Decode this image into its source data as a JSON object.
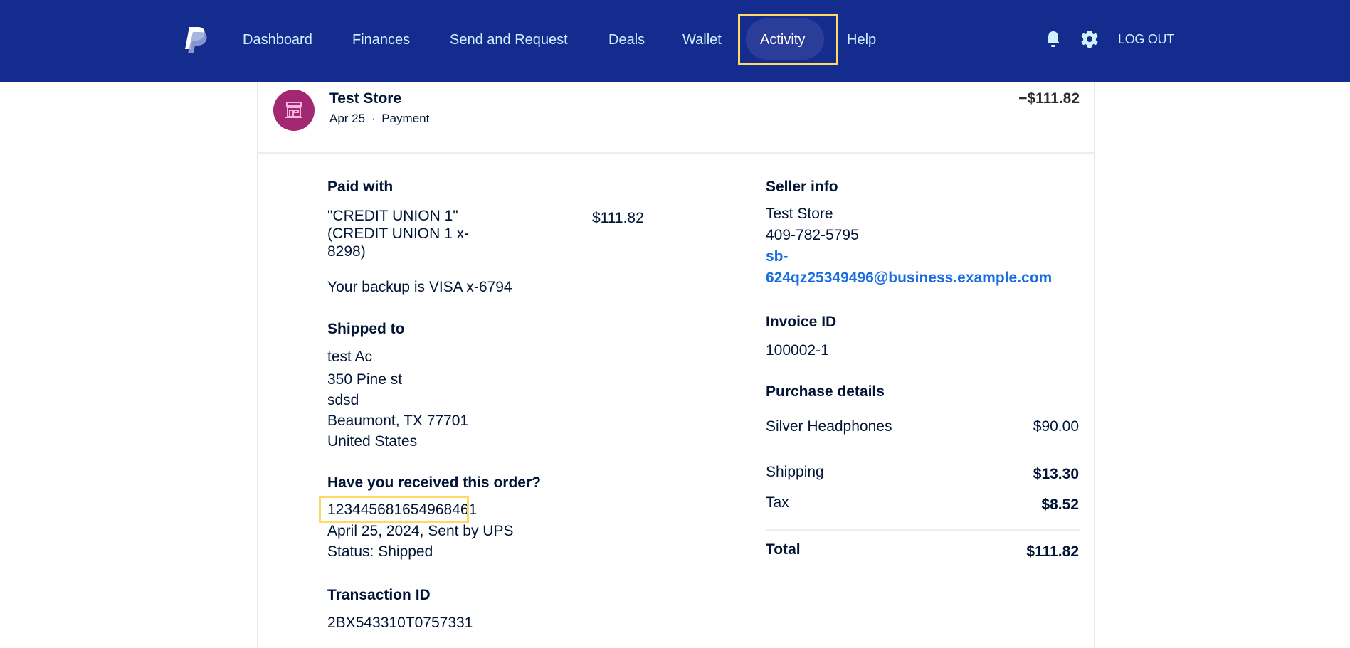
{
  "nav": {
    "items": [
      {
        "label": "Dashboard"
      },
      {
        "label": "Finances"
      },
      {
        "label": "Send and Request"
      },
      {
        "label": "Deals"
      },
      {
        "label": "Wallet"
      },
      {
        "label": "Activity",
        "active": true
      },
      {
        "label": "Help"
      }
    ],
    "notifications_icon": "bell-icon",
    "settings_icon": "gear-icon",
    "logout_label": "LOG OUT"
  },
  "transaction": {
    "merchant": "Test Store",
    "merchant_icon": "storefront-icon",
    "date": "Apr 25",
    "separator": "·",
    "type": "Payment",
    "amount": "−$111.82"
  },
  "paid_with": {
    "title": "Paid with",
    "lines": [
      "\"CREDIT UNION 1\"",
      "(CREDIT UNION 1 x-",
      "8298)"
    ],
    "amount": "$111.82",
    "backup": "Your backup is VISA x-6794"
  },
  "shipped_to": {
    "title": "Shipped to",
    "lines": [
      "test Ac",
      "350 Pine st",
      "sdsd",
      "Beaumont, TX 77701",
      "United States"
    ]
  },
  "order_received": {
    "title": "Have you received this order?",
    "tracking_number": "123445681654968461",
    "shipment": "April 25, 2024, Sent by UPS",
    "status": "Status: Shipped"
  },
  "transaction_id": {
    "title": "Transaction ID",
    "value": "2BX543310T0757331"
  },
  "seller_info": {
    "title": "Seller info",
    "name": "Test Store",
    "phone": "409-782-5795",
    "email_line1": "sb-",
    "email_line2": "624qz25349496@business.example.com"
  },
  "invoice": {
    "title": "Invoice ID",
    "value": "100002-1"
  },
  "purchase_details": {
    "title": "Purchase details",
    "items": [
      {
        "name": "Silver Headphones",
        "price": "$90.00"
      }
    ],
    "shipping_label": "Shipping",
    "shipping_value": "$13.30",
    "tax_label": "Tax",
    "tax_value": "$8.52",
    "total_label": "Total",
    "total_value": "$111.82"
  },
  "colors": {
    "header_bg": "#142c8e",
    "nav_text": "#d1f1ff",
    "highlight": "#ffd966",
    "merchant_avatar": "#a12871",
    "link": "#1a6dde"
  }
}
